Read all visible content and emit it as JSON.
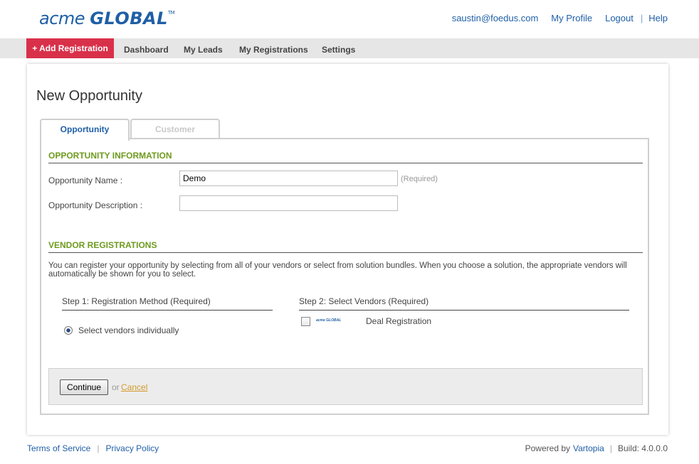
{
  "brand": {
    "word1": "acme",
    "word2": "GLOBAL",
    "tm": "TM"
  },
  "top_links": {
    "email": "saustin@foedus.com",
    "profile": "My Profile",
    "logout": "Logout",
    "separator": "|",
    "help": "Help"
  },
  "nav": {
    "add_registration": "+ Add Registration",
    "items": [
      "Dashboard",
      "My Leads",
      "My Registrations",
      "Settings"
    ]
  },
  "page": {
    "title": "New Opportunity"
  },
  "tabs": [
    {
      "label": "Opportunity",
      "state": "active"
    },
    {
      "label": "Customer",
      "state": "disabled"
    }
  ],
  "opportunity_info": {
    "heading": "OPPORTUNITY INFORMATION",
    "name_label": "Opportunity Name :",
    "name_value": "Demo",
    "name_required": "(Required)",
    "description_label": "Opportunity Description :",
    "description_value": ""
  },
  "vendor_registrations": {
    "heading": "VENDOR REGISTRATIONS",
    "description": "You can register your opportunity by selecting from all of your vendors or select from solution bundles. When you choose a solution, the appropriate vendors will automatically be shown for you to select.",
    "step1_heading": "Step 1: Registration Method (Required)",
    "step1_option": "Select vendors individually",
    "step2_heading": "Step 2: Select Vendors (Required)",
    "vendor_logo_text": "acme GLOBAL",
    "vendor_name": "Deal Registration"
  },
  "actions": {
    "continue": "Continue",
    "or": "or",
    "cancel": "Cancel"
  },
  "footer": {
    "terms": "Terms of Service",
    "privacy": "Privacy Policy",
    "separator": "|",
    "powered_by": "Powered by",
    "vartopia": "Vartopia",
    "build": "Build: 4.0.0.0"
  },
  "colors": {
    "brand_blue": "#1f5fa6",
    "add_button_red": "#d9304a",
    "section_green": "#6e9a1e",
    "cancel_orange": "#d39a2a"
  }
}
